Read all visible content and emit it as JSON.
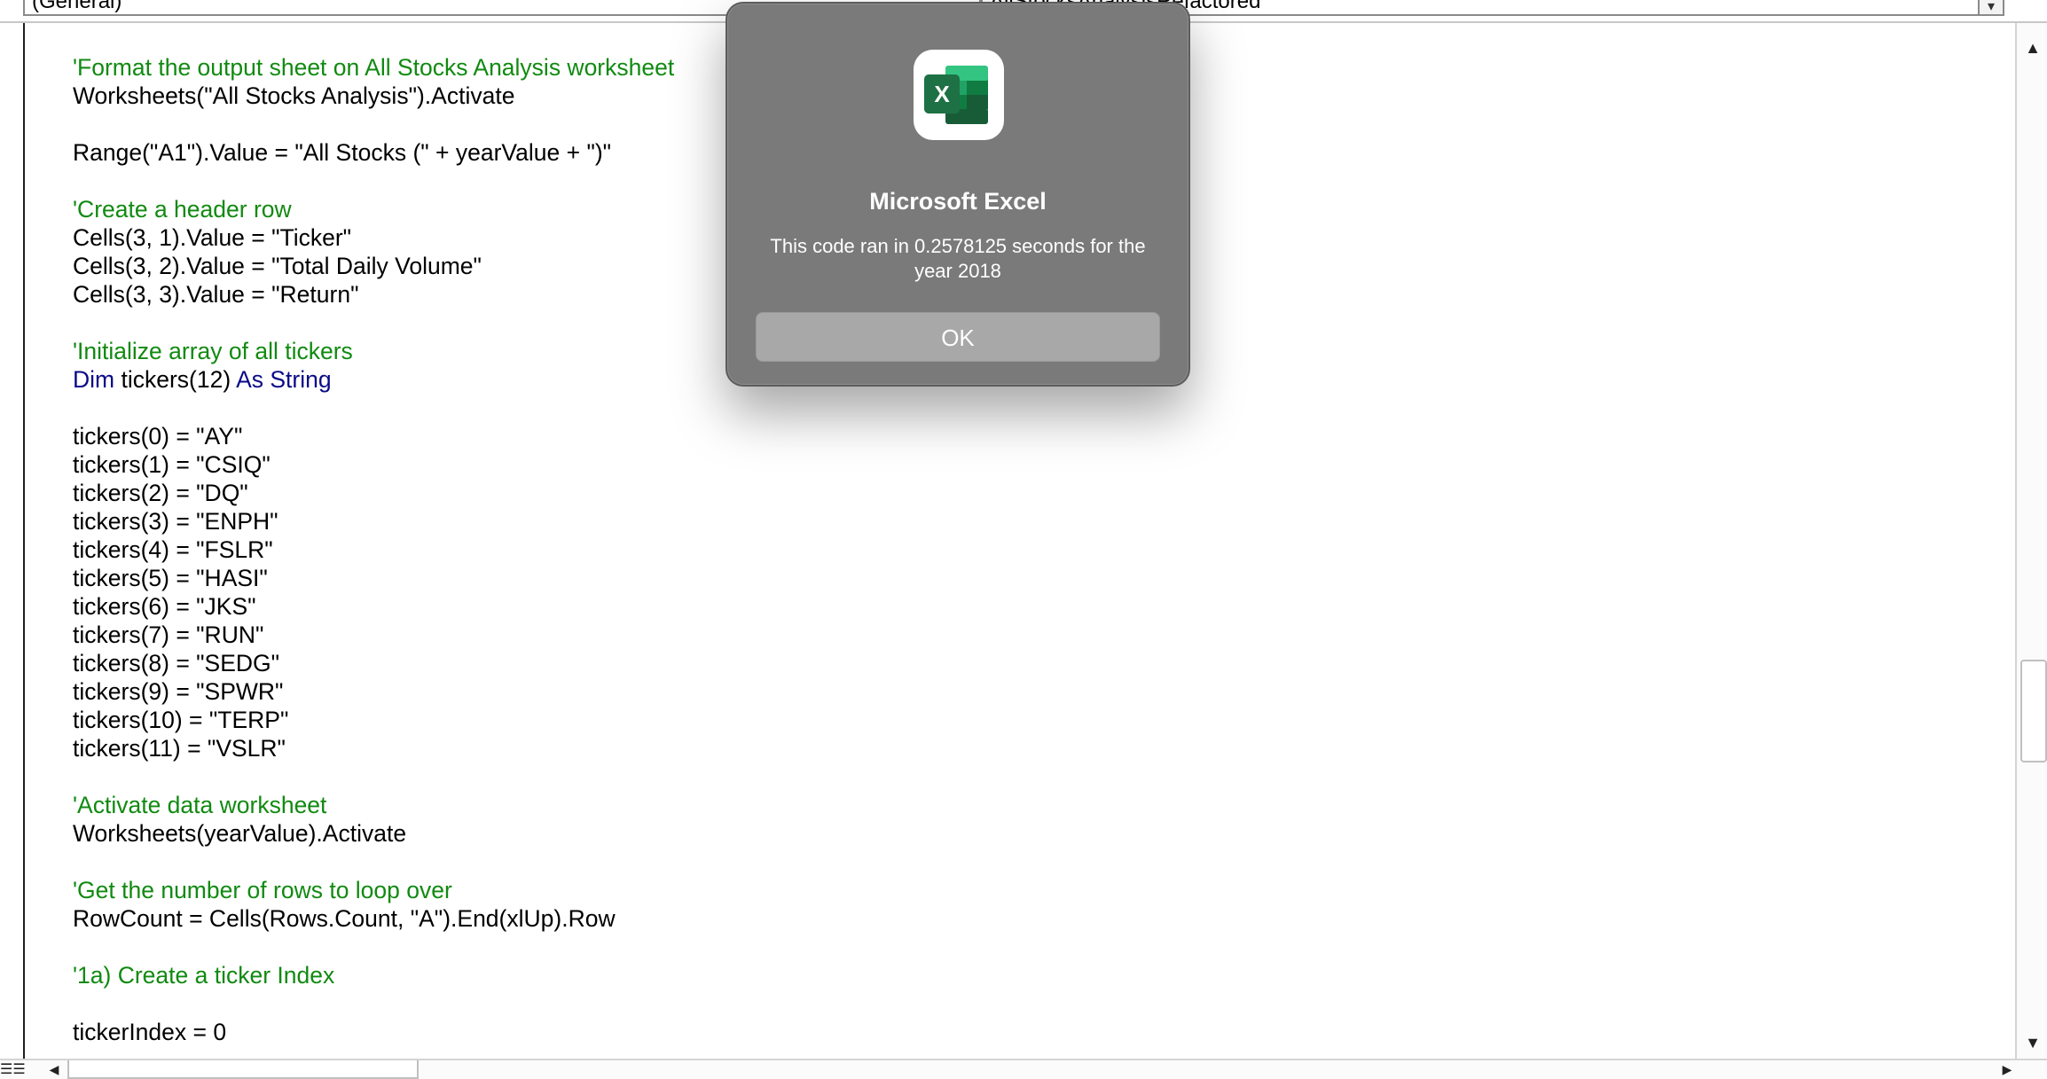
{
  "top_bar": {
    "object_combo": "(General)",
    "procedure_combo": "AllStocksAnalysisRefactored"
  },
  "code": {
    "lines": [
      {
        "text": "'Format the output sheet on All Stocks Analysis worksheet",
        "kind": "comment"
      },
      {
        "text": "Worksheets(\"All Stocks Analysis\").Activate",
        "kind": "code"
      },
      {
        "text": "",
        "kind": "blank"
      },
      {
        "text": "Range(\"A1\").Value = \"All Stocks (\" + yearValue + \")\"",
        "kind": "code"
      },
      {
        "text": "",
        "kind": "blank"
      },
      {
        "text": "'Create a header row",
        "kind": "comment"
      },
      {
        "text": "Cells(3, 1).Value = \"Ticker\"",
        "kind": "code"
      },
      {
        "text": "Cells(3, 2).Value = \"Total Daily Volume\"",
        "kind": "code"
      },
      {
        "text": "Cells(3, 3).Value = \"Return\"",
        "kind": "code"
      },
      {
        "text": "",
        "kind": "blank"
      },
      {
        "text": "'Initialize array of all tickers",
        "kind": "comment"
      },
      {
        "parts": [
          {
            "t": "Dim",
            "k": "kw"
          },
          {
            "t": " tickers(12) ",
            "k": "code"
          },
          {
            "t": "As String",
            "k": "kw"
          }
        ],
        "kind": "mixed"
      },
      {
        "text": "",
        "kind": "blank"
      },
      {
        "text": "tickers(0) = \"AY\"",
        "kind": "code"
      },
      {
        "text": "tickers(1) = \"CSIQ\"",
        "kind": "code"
      },
      {
        "text": "tickers(2) = \"DQ\"",
        "kind": "code"
      },
      {
        "text": "tickers(3) = \"ENPH\"",
        "kind": "code"
      },
      {
        "text": "tickers(4) = \"FSLR\"",
        "kind": "code"
      },
      {
        "text": "tickers(5) = \"HASI\"",
        "kind": "code"
      },
      {
        "text": "tickers(6) = \"JKS\"",
        "kind": "code"
      },
      {
        "text": "tickers(7) = \"RUN\"",
        "kind": "code"
      },
      {
        "text": "tickers(8) = \"SEDG\"",
        "kind": "code"
      },
      {
        "text": "tickers(9) = \"SPWR\"",
        "kind": "code"
      },
      {
        "text": "tickers(10) = \"TERP\"",
        "kind": "code"
      },
      {
        "text": "tickers(11) = \"VSLR\"",
        "kind": "code"
      },
      {
        "text": "",
        "kind": "blank"
      },
      {
        "text": "'Activate data worksheet",
        "kind": "comment"
      },
      {
        "text": "Worksheets(yearValue).Activate",
        "kind": "code"
      },
      {
        "text": "",
        "kind": "blank"
      },
      {
        "text": "'Get the number of rows to loop over",
        "kind": "comment"
      },
      {
        "text": "RowCount = Cells(Rows.Count, \"A\").End(xlUp).Row",
        "kind": "code"
      },
      {
        "text": "",
        "kind": "blank"
      },
      {
        "text": "'1a) Create a ticker Index",
        "kind": "comment"
      },
      {
        "text": "",
        "kind": "blank"
      },
      {
        "text": "tickerIndex = 0",
        "kind": "code"
      }
    ]
  },
  "dialog": {
    "app_name": "Microsoft Excel",
    "message": "This code ran in 0.2578125 seconds for the year 2018",
    "ok_label": "OK",
    "icon": "excel-icon",
    "icon_letter": "X"
  },
  "colors": {
    "comment": "#118a11",
    "keyword": "#0a0a88",
    "dialog_bg": "#7a7a7a",
    "button_bg": "#a8a8a8",
    "excel_green": "#1e7145"
  },
  "scrollbar": {
    "vertical_position": 0.62,
    "horizontal_position": 0.0
  }
}
